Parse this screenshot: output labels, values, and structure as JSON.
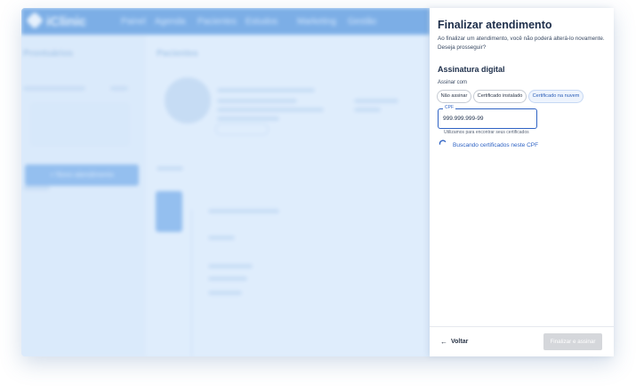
{
  "background": {
    "logo_text": "iClinic",
    "nav": [
      "Painel",
      "Agenda",
      "Pacientes",
      "Estudos",
      "Marketing",
      "Gestão"
    ],
    "left_title": "Prontuários",
    "new_visit_button": "+ Novo atendimento",
    "main_title": "Pacientes"
  },
  "drawer": {
    "title": "Finalizar atendimento",
    "description_line1": "Ao finalizar um atendimento, você não poderá alterá-lo novamente.",
    "description_line2": "Deseja prosseguir?",
    "signature_heading": "Assinatura digital",
    "sign_with_label": "Assinar com",
    "options": [
      {
        "label": "Não assinar",
        "selected": false
      },
      {
        "label": "Certificado instalado",
        "selected": false
      },
      {
        "label": "Certificado na nuvem",
        "selected": true
      }
    ],
    "cpf": {
      "label": "CPF",
      "value": "999.999.999-99",
      "helper": "Utilizamos para encontrar seus certificados"
    },
    "loading_text": "Buscando certificados neste CPF",
    "back_label": "Voltar",
    "finish_label": "Finalizar e assinar"
  },
  "colors": {
    "accent": "#2f63c4",
    "disabled_button": "#d5d7db",
    "brand_topbar": "#3f86d6"
  },
  "icons": {
    "back": "arrow-left-icon",
    "loading": "spinner-icon",
    "logo": "iclinic-logo-icon"
  }
}
